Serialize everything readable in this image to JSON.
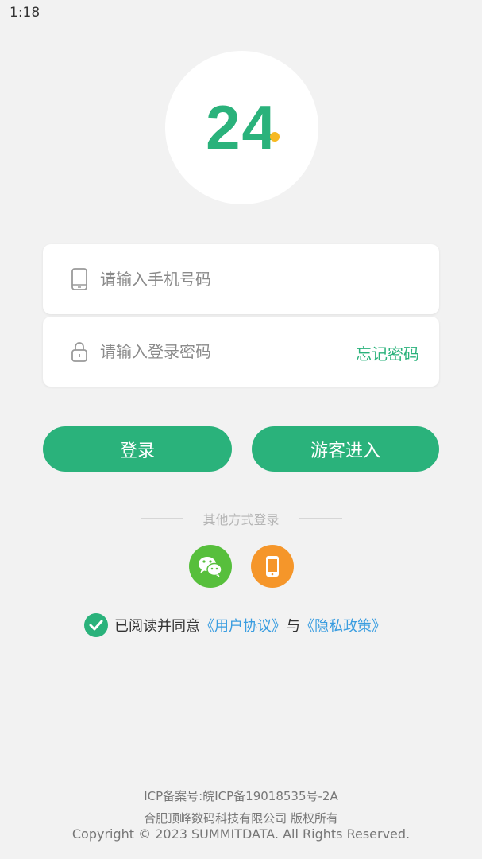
{
  "status_bar": {
    "time": "1:18"
  },
  "logo": {
    "text": "24",
    "accent_color": "#2ab27b",
    "dot_color": "#f6b922"
  },
  "form": {
    "phone_placeholder": "请输入手机号码",
    "phone_value": "",
    "phone_icon": "smartphone-icon",
    "password_placeholder": "请输入登录密码",
    "password_value": "",
    "password_icon": "lock-icon",
    "forgot_label": "忘记密码"
  },
  "buttons": {
    "login_label": "登录",
    "guest_label": "游客进入"
  },
  "other_login": {
    "label": "其他方式登录",
    "methods": [
      {
        "icon": "wechat-icon",
        "color": "#57bf3c"
      },
      {
        "icon": "phone-login-icon",
        "color": "#f5962a"
      }
    ]
  },
  "agreement": {
    "checked": true,
    "prefix": "已阅读并同意",
    "user_agreement": "《用户协议》",
    "connector": "与",
    "privacy_policy": "《隐私政策》",
    "link_color": "#3a9de0"
  },
  "footer": {
    "icp": "ICP备案号:皖ICP备19018535号-2A",
    "company": "合肥顶峰数码科技有限公司 版权所有",
    "copyright": "Copyright © 2023 SUMMITDATA. All Rights Reserved."
  }
}
